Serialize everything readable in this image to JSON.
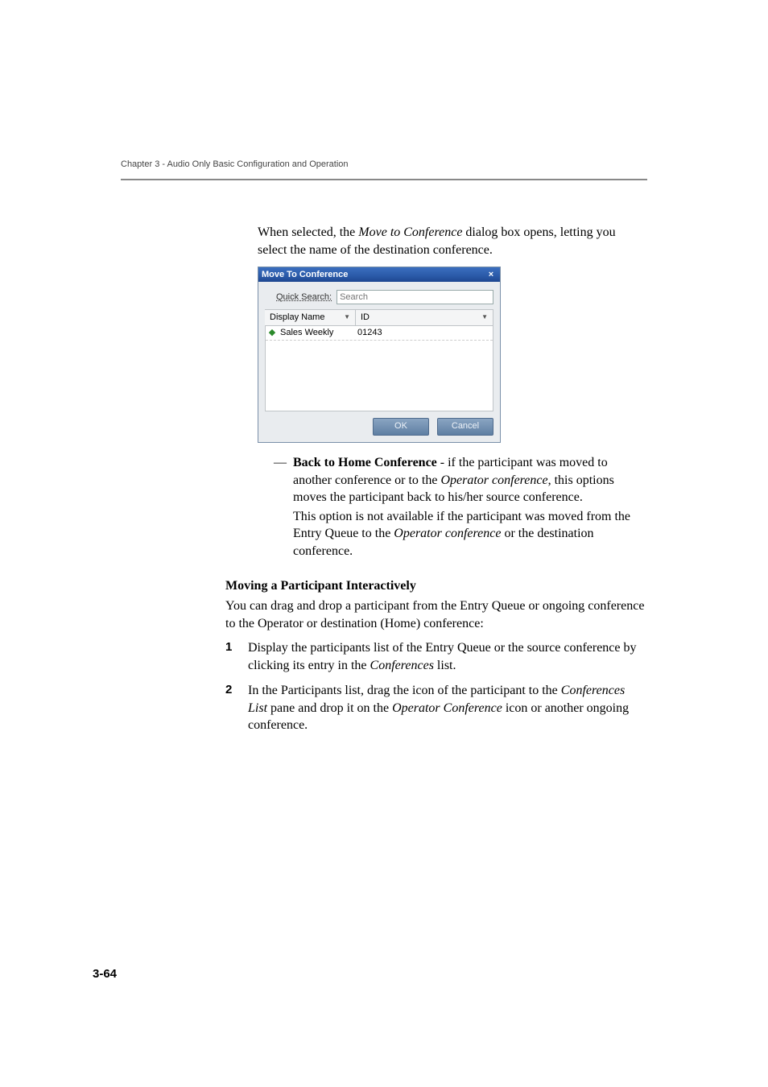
{
  "header": {
    "chapter_line": "Chapter 3 - Audio Only Basic Configuration and Operation"
  },
  "intro": {
    "prefix": "When selected, the ",
    "dialog_name": "Move to Conference",
    "suffix": " dialog box opens, letting you select the name of the destination conference."
  },
  "dialog": {
    "title": "Move To Conference",
    "close_glyph": "×",
    "quick_search_label": "Quick Search:",
    "search_placeholder": "Search",
    "columns": {
      "display_name": "Display Name",
      "id": "ID"
    },
    "row": {
      "name": "Sales Weekly",
      "id": "01243"
    },
    "ok_label": "OK",
    "cancel_label": "Cancel"
  },
  "back_item": {
    "dash": "—",
    "title": "Back to Home Conference",
    "body1_a": " - if the participant was moved to another conference or to the ",
    "body1_b_italic": "Operator conference",
    "body1_c": ", this options moves the participant back to his/her source conference.",
    "body2_a": "This option is not available if the participant was moved from the Entry Queue to the ",
    "body2_b_italic": "Operator conference",
    "body2_c": " or the destination conference."
  },
  "moving": {
    "heading": "Moving a Participant Interactively",
    "para": "You can drag and drop a participant from the Entry Queue or ongoing conference to the Operator or destination (Home) conference:"
  },
  "steps": [
    {
      "num": "1",
      "a": "Display the participants list of the Entry Queue or the source conference by clicking its entry in the ",
      "b_italic": "Conferences",
      "c": " list."
    },
    {
      "num": "2",
      "a": "In the Participants list, drag the icon of the participant to the ",
      "b_italic": "Conferences List",
      "c": " pane and drop it on the ",
      "d_italic": "Operator Conference",
      "e": " icon or another ongoing conference."
    }
  ],
  "page_number": "3-64"
}
